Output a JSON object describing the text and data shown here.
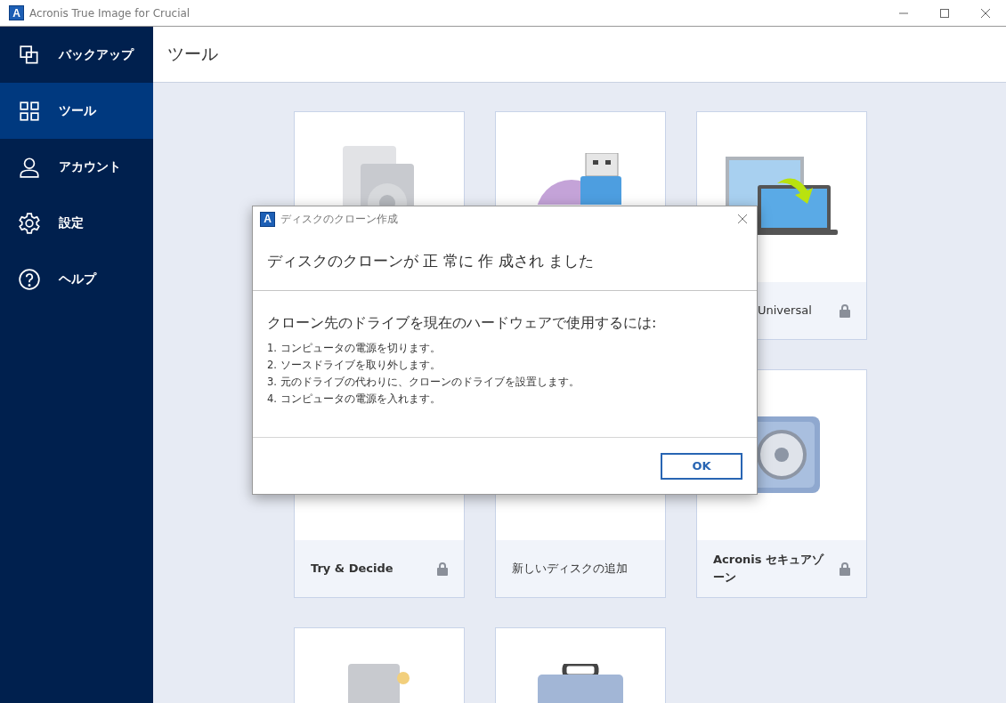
{
  "window": {
    "logo_letter": "A",
    "title": "Acronis True Image for Crucial"
  },
  "sidebar": {
    "items": [
      {
        "label": "バックアップ",
        "selected": false
      },
      {
        "label": "ツール",
        "selected": true
      },
      {
        "label": "アカウント",
        "selected": false
      },
      {
        "label": "設定",
        "selected": false
      },
      {
        "label": "ヘルプ",
        "selected": false
      }
    ]
  },
  "header": {
    "title": "ツール"
  },
  "tiles": [
    {
      "label": "Universal",
      "locked": true
    },
    {
      "label": "Try & Decide",
      "bold": true,
      "locked": true
    },
    {
      "label": "新しいディスクの追加",
      "bold": false,
      "locked": false
    },
    {
      "label": "Acronis セキュアゾーン",
      "bold": true,
      "locked": true
    }
  ],
  "dialog": {
    "logo_letter": "A",
    "title": "ディスクのクローン作成",
    "heading": "ディスクのクローンが 正 常に 作 成され ました",
    "subheading": "クローン先のドライブを現在のハードウェアで使用するには:",
    "steps": [
      "1. コンピュータの電源を切ります。",
      "2. ソースドライブを取り外します。",
      "3. 元のドライブの代わりに、クローンのドライブを設置します。",
      "4. コンピュータの電源を入れます。"
    ],
    "buttons": [
      "OK"
    ]
  }
}
